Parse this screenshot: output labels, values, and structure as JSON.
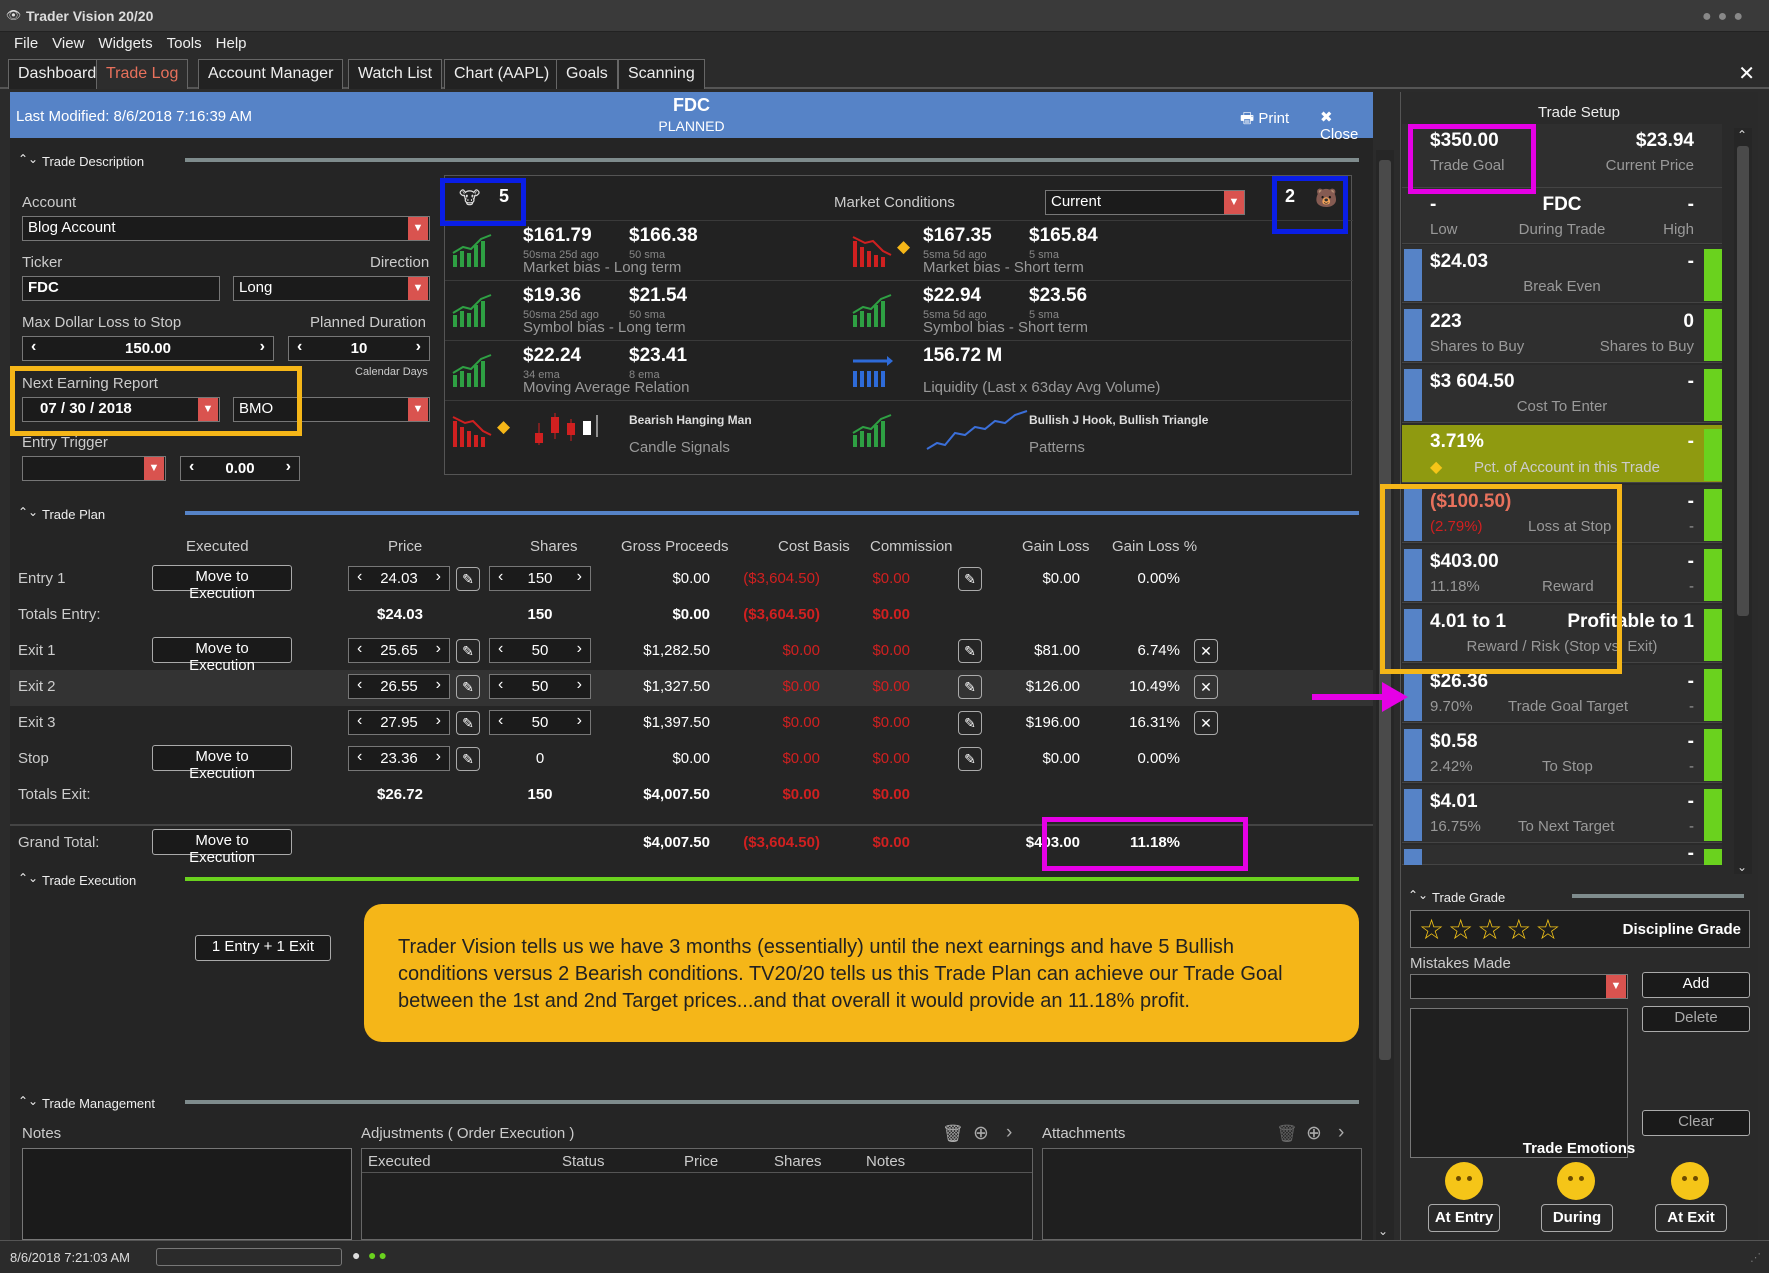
{
  "window": {
    "title": "Trader Vision 20/20"
  },
  "menu": [
    "File",
    "View",
    "Widgets",
    "Tools",
    "Help"
  ],
  "tabs": [
    "Dashboard",
    "Trade Log",
    "Account Manager",
    "Watch List",
    "Chart (AAPL)",
    "Goals",
    "Scanning"
  ],
  "header": {
    "last_modified": "Last Modified: 8/6/2018 7:16:39 AM",
    "ticker": "FDC",
    "status": "PLANNED",
    "print": "Print",
    "close": "Close"
  },
  "sections": {
    "desc": "Trade Description",
    "plan": "Trade Plan",
    "exec": "Trade Execution",
    "mgmt": "Trade Management"
  },
  "desc": {
    "account_label": "Account",
    "account": "Blog Account",
    "ticker_label": "Ticker",
    "ticker": "FDC",
    "direction_label": "Direction",
    "direction": "Long",
    "maxloss_label": "Max Dollar Loss to Stop",
    "maxloss": "150.00",
    "duration_label": "Planned Duration",
    "duration": "10",
    "duration_unit": "Calendar Days",
    "earning_label": "Next Earning Report",
    "earning_m": "07",
    "earning_d": "30",
    "earning_y": "2018",
    "earning_when": "BMO",
    "trigger_label": "Entry Trigger",
    "trigger": "0.00"
  },
  "market": {
    "bull_count": "5",
    "bear_count": "2",
    "title": "Market Conditions",
    "period": "Current",
    "r1a": {
      "v1": "$161.79",
      "s1": "50sma 25d ago",
      "v2": "$166.38",
      "s2": "50 sma",
      "d": "Market bias - Long term"
    },
    "r1b": {
      "v1": "$167.35",
      "s1": "5sma 5d ago",
      "v2": "$165.84",
      "s2": "5 sma",
      "d": "Market bias - Short term"
    },
    "r2a": {
      "v1": "$19.36",
      "s1": "50sma 25d ago",
      "v2": "$21.54",
      "s2": "50 sma",
      "d": "Symbol bias - Long term"
    },
    "r2b": {
      "v1": "$22.94",
      "s1": "5sma 5d ago",
      "v2": "$23.56",
      "s2": "5 sma",
      "d": "Symbol bias - Short term"
    },
    "r3a": {
      "v1": "$22.24",
      "s1": "34 ema",
      "v2": "$23.41",
      "s2": "8 ema",
      "d": "Moving Average Relation"
    },
    "r3b": {
      "v1": "156.72 M",
      "d": "Liquidity (Last x 63day Avg Volume)"
    },
    "r4a": {
      "n": "Bearish Hanging Man",
      "d": "Candle Signals"
    },
    "r4b": {
      "n": "Bullish J Hook, Bullish Triangle",
      "d": "Patterns"
    }
  },
  "plan": {
    "headers": [
      "Executed",
      "Price",
      "Shares",
      "Gross Proceeds",
      "Cost Basis",
      "Commission",
      "Gain Loss",
      "Gain Loss %"
    ],
    "move": "Move to Execution",
    "entry1": {
      "label": "Entry 1",
      "price": "24.03",
      "shares": "150",
      "gross": "$0.00",
      "cost": "($3,604.50)",
      "comm": "$0.00",
      "gl": "$0.00",
      "glp": "0.00%"
    },
    "totals_entry": {
      "label": "Totals Entry:",
      "price": "$24.03",
      "shares": "150",
      "gross": "$0.00",
      "cost": "($3,604.50)",
      "comm": "$0.00"
    },
    "exit1": {
      "label": "Exit 1",
      "price": "25.65",
      "shares": "50",
      "gross": "$1,282.50",
      "cost": "$0.00",
      "comm": "$0.00",
      "gl": "$81.00",
      "glp": "6.74%"
    },
    "exit2": {
      "label": "Exit 2",
      "price": "26.55",
      "shares": "50",
      "gross": "$1,327.50",
      "cost": "$0.00",
      "comm": "$0.00",
      "gl": "$126.00",
      "glp": "10.49%"
    },
    "exit3": {
      "label": "Exit 3",
      "price": "27.95",
      "shares": "50",
      "gross": "$1,397.50",
      "cost": "$0.00",
      "comm": "$0.00",
      "gl": "$196.00",
      "glp": "16.31%"
    },
    "stop": {
      "label": "Stop",
      "price": "23.36",
      "shares": "0",
      "gross": "$0.00",
      "cost": "$0.00",
      "comm": "$0.00",
      "gl": "$0.00",
      "glp": "0.00%"
    },
    "totals_exit": {
      "label": "Totals Exit:",
      "price": "$26.72",
      "shares": "150",
      "gross": "$4,007.50",
      "cost": "$0.00",
      "comm": "$0.00"
    },
    "grand": {
      "label": "Grand Total:",
      "gross": "$4,007.50",
      "cost": "($3,604.50)",
      "comm": "$0.00",
      "gl": "$403.00",
      "glp": "11.18%"
    }
  },
  "exec": {
    "button": "1 Entry + 1 Exit",
    "callout": "Trader Vision tells us we have 3 months (essentially) until the next earnings and have 5 Bullish conditions versus 2 Bearish conditions.  TV20/20 tells us this Trade Plan can achieve our Trade Goal between the 1st and 2nd Target prices...and that overall it would provide an 11.18% profit."
  },
  "mgmt": {
    "notes": "Notes",
    "adjust": "Adjustments ( Order Execution )",
    "attach": "Attachments",
    "cols": [
      "Executed",
      "Status",
      "Price",
      "Shares",
      "Notes"
    ]
  },
  "setup": {
    "title": "Trade Setup",
    "goal": "$350.00",
    "goal_l": "Trade Goal",
    "price": "$23.94",
    "price_l": "Current Price",
    "low": "-",
    "low_l": "Low",
    "tk": "FDC",
    "tk_l": "During Trade",
    "high": "-",
    "high_l": "High",
    "be": "$24.03",
    "be_l": "Break Even",
    "dash": "-",
    "sb1": "223",
    "sb2": "0",
    "sb_l": "Shares to Buy",
    "cost": "$3 604.50",
    "cost_l": "Cost To Enter",
    "pct": "3.71%",
    "pct_l": "Pct. of Account in this Trade",
    "loss": "($100.50)",
    "loss_p": "(2.79%)",
    "loss_l": "Loss at Stop",
    "rew": "$403.00",
    "rew_p": "11.18%",
    "rew_l": "Reward",
    "rr": "4.01 to 1",
    "rr2": "Profitable to 1",
    "rr_l": "Reward / Risk (Stop vs. Exit)",
    "tgt": "$26.36",
    "tgt_p": "9.70%",
    "tgt_l": "Trade Goal Target",
    "ts": "$0.58",
    "ts_p": "2.42%",
    "ts_l": "To Stop",
    "nt": "$4.01",
    "nt_p": "16.75%",
    "nt_l": "To Next Target"
  },
  "grade": {
    "title": "Trade Grade",
    "disc": "Discipline Grade",
    "mistakes": "Mistakes Made",
    "add": "Add",
    "delete": "Delete",
    "clear": "Clear",
    "emotions": "Trade Emotions",
    "e1": "At Entry",
    "e2": "During",
    "e3": "At Exit"
  },
  "status": {
    "time": "8/6/2018 7:21:03 AM"
  },
  "colors": {
    "accent": "#5683c7",
    "green": "#6ad21e",
    "magenta": "#e600e6",
    "gold": "#f5b618",
    "blue": "#0a1ee6"
  }
}
